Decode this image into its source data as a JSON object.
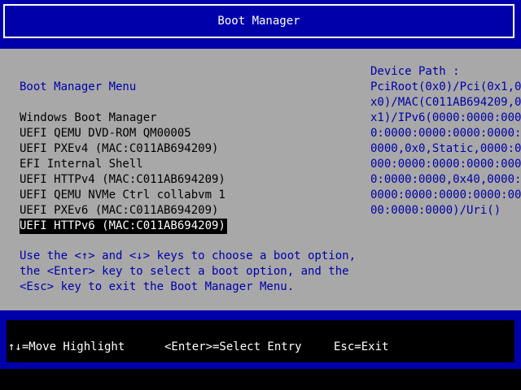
{
  "header": {
    "title": "Boot Manager"
  },
  "menu": {
    "title": "Boot Manager Menu",
    "items": [
      {
        "label": "Windows Boot Manager"
      },
      {
        "label": "UEFI QEMU DVD-ROM QM00005"
      },
      {
        "label": "UEFI PXEv4 (MAC:C011AB694209)"
      },
      {
        "label": "EFI Internal Shell"
      },
      {
        "label": "UEFI HTTPv4 (MAC:C011AB694209)"
      },
      {
        "label": "UEFI QEMU NVMe Ctrl collabvm 1"
      },
      {
        "label": "UEFI PXEv6 (MAC:C011AB694209)"
      },
      {
        "label": "UEFI HTTPv6 (MAC:C011AB694209)"
      }
    ],
    "selected_label": "UEFI HTTPv6 (MAC:C011AB694209)"
  },
  "help": {
    "lines": [
      "Use the <↑> and <↓> keys to choose a boot option,",
      "the <Enter> key to select a boot option, and the",
      "<Esc> key to exit the Boot Manager Menu."
    ]
  },
  "device_path": {
    "lines": [
      "Device Path :",
      "PciRoot(0x0)/Pci(0x1,0",
      "x0)/MAC(C011AB694209,0",
      "x1)/IPv6(0000:0000:000",
      "0:0000:0000:0000:0000:",
      "0000,0x0,Static,0000:0",
      "000:0000:0000:0000:000",
      "0:0000:0000,0x40,0000:",
      "0000:0000:0000:0000:00",
      "00:0000:0000)/Uri()"
    ]
  },
  "footer": {
    "move_hint": "↑↓=Move Highlight",
    "enter_hint": "<Enter>=Select Entry",
    "esc_hint": "Esc=Exit"
  },
  "colors": {
    "frame_blue": "#0000aa",
    "panel_gray": "#a8a8a8",
    "text_blue": "#0000aa",
    "highlight_bg": "#000000",
    "highlight_fg": "#ffffff"
  }
}
